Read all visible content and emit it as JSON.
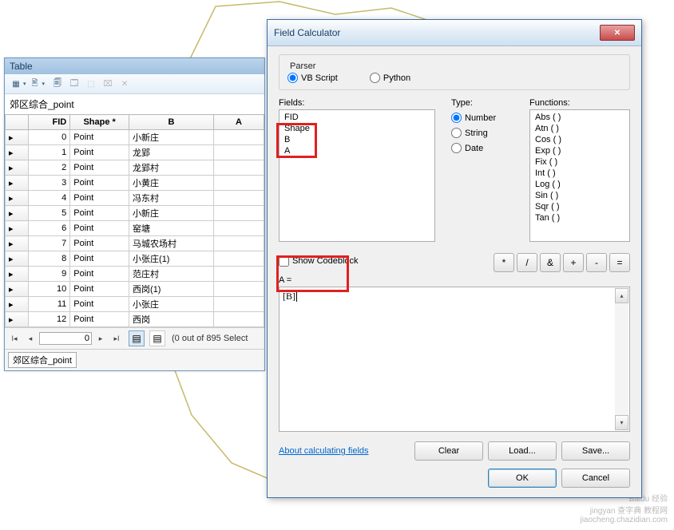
{
  "table": {
    "windowTitle": "Table",
    "layerName": "郊区综合_point",
    "tabName": "郊区综合_point",
    "columns": [
      "FID",
      "Shape *",
      "B",
      "A"
    ],
    "rows": [
      {
        "fid": "0",
        "shape": "Point",
        "b": "小新庄",
        "a": ""
      },
      {
        "fid": "1",
        "shape": "Point",
        "b": "龙郢",
        "a": ""
      },
      {
        "fid": "2",
        "shape": "Point",
        "b": "龙郢村",
        "a": ""
      },
      {
        "fid": "3",
        "shape": "Point",
        "b": "小黄庄",
        "a": ""
      },
      {
        "fid": "4",
        "shape": "Point",
        "b": "冯东村",
        "a": ""
      },
      {
        "fid": "5",
        "shape": "Point",
        "b": "小新庄",
        "a": ""
      },
      {
        "fid": "6",
        "shape": "Point",
        "b": "窑塘",
        "a": ""
      },
      {
        "fid": "7",
        "shape": "Point",
        "b": "马城农场村",
        "a": ""
      },
      {
        "fid": "8",
        "shape": "Point",
        "b": "小张庄(1)",
        "a": ""
      },
      {
        "fid": "9",
        "shape": "Point",
        "b": "范庄村",
        "a": ""
      },
      {
        "fid": "10",
        "shape": "Point",
        "b": "西岗(1)",
        "a": ""
      },
      {
        "fid": "11",
        "shape": "Point",
        "b": "小张庄",
        "a": ""
      },
      {
        "fid": "12",
        "shape": "Point",
        "b": "西岗",
        "a": ""
      }
    ],
    "nav": {
      "current": "0",
      "status": "(0 out of 895 Select"
    }
  },
  "dialog": {
    "title": "Field Calculator",
    "parser": {
      "legend": "Parser",
      "vb": "VB Script",
      "py": "Python",
      "selected": "vb"
    },
    "fieldsLabel": "Fields:",
    "fields": [
      "FID",
      "Shape",
      "B",
      "A"
    ],
    "typeLabel": "Type:",
    "types": {
      "number": "Number",
      "string": "String",
      "date": "Date",
      "selected": "number"
    },
    "functionsLabel": "Functions:",
    "functions": [
      "Abs ( )",
      "Atn ( )",
      "Cos ( )",
      "Exp ( )",
      "Fix ( )",
      "Int ( )",
      "Log ( )",
      "Sin ( )",
      "Sqr ( )",
      "Tan ( )"
    ],
    "operators": [
      "*",
      "/",
      "&",
      "+",
      "-",
      "="
    ],
    "showCodeblock": "Show Codeblock",
    "exprLabel": "A =",
    "exprValue": "[B]",
    "aboutLink": "About calculating fields",
    "buttons": {
      "clear": "Clear",
      "load": "Load...",
      "save": "Save...",
      "ok": "OK",
      "cancel": "Cancel"
    }
  },
  "watermark": {
    "l1": "Baidu 经验",
    "l2": "jingyan  查字典 教程网",
    "l3": "jiaocheng.chazidian.com"
  }
}
